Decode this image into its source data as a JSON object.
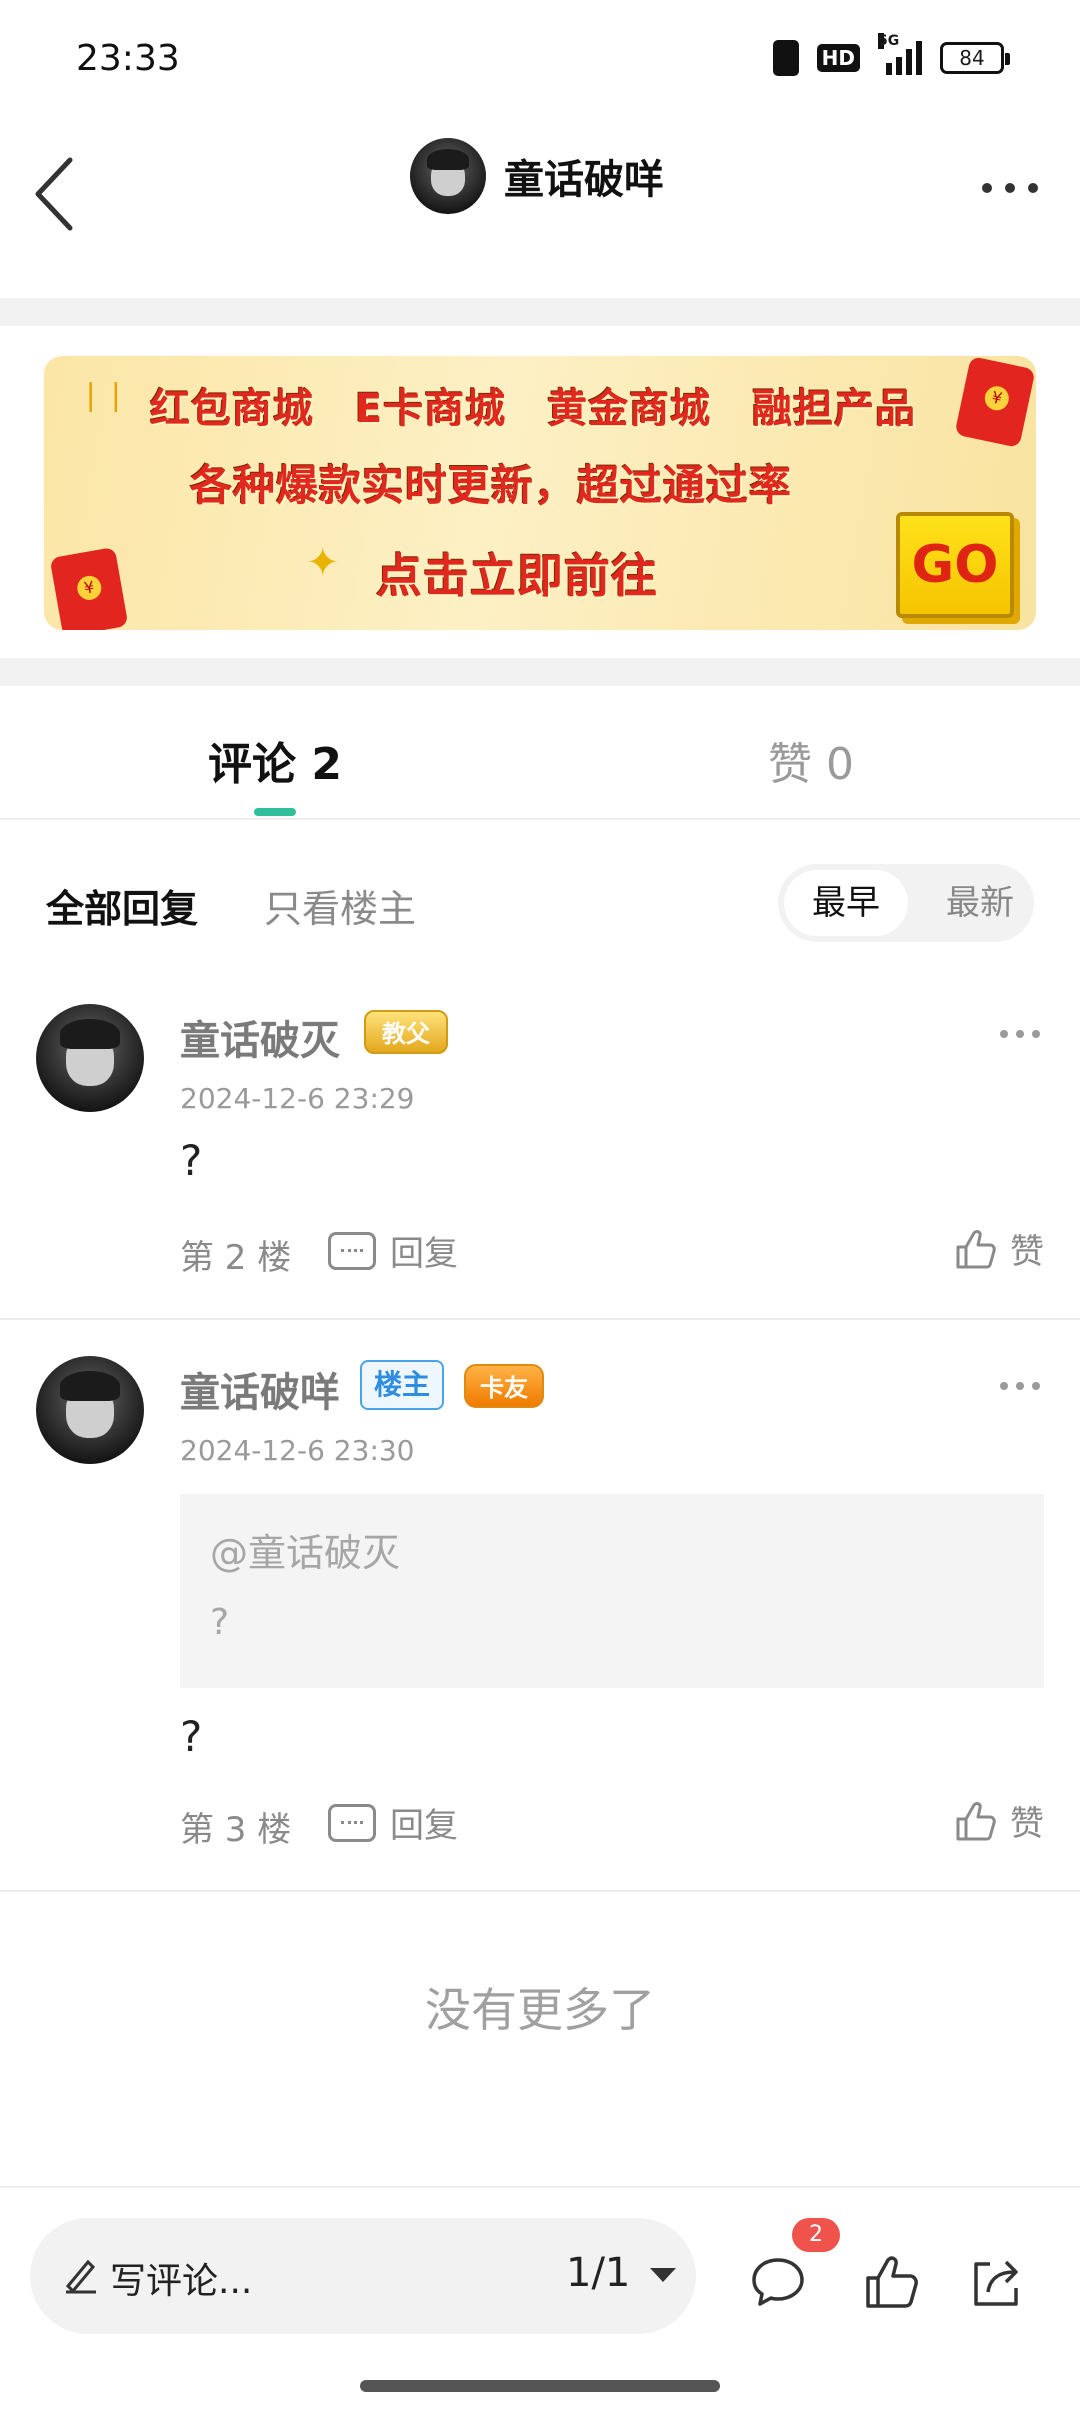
{
  "status_bar": {
    "time": "23:33",
    "hd": "HD",
    "network": "5G",
    "battery": "84"
  },
  "nav": {
    "title": "童话破咩",
    "back_icon": "chevron-left-icon",
    "more_icon": "more-horizontal-icon"
  },
  "banner": {
    "line1": "红包商城 E卡商城 黄金商城 融担产品",
    "line2": "各种爆款实时更新，超过通过率",
    "line3": "点击立即前往",
    "go": "GO"
  },
  "tabs": {
    "comments": "评论 2",
    "likes": "赞 0"
  },
  "filters": {
    "all": "全部回复",
    "op_only": "只看楼主",
    "sort_earliest": "最早",
    "sort_latest": "最新"
  },
  "comments": [
    {
      "name": "童话破灭",
      "badge": "教父",
      "time": "2024-12-6 23:29",
      "text": "?",
      "floor": "第 2 楼",
      "reply": "回复",
      "like": "赞"
    },
    {
      "name": "童话破咩",
      "op_badge": "楼主",
      "badge": "卡友",
      "time": "2024-12-6 23:30",
      "quote_name": "@童话破灭",
      "quote_text": "?",
      "text": "?",
      "floor": "第 3 楼",
      "reply": "回复",
      "like": "赞"
    }
  ],
  "no_more": "没有更多了",
  "bottom_bar": {
    "write_placeholder": "写评论...",
    "page_indicator": "1/1",
    "comment_count_badge": "2"
  },
  "colors": {
    "accent": "#2fbf9a",
    "badge_red": "#f0524c",
    "op_badge_blue": "#2e8de0"
  }
}
